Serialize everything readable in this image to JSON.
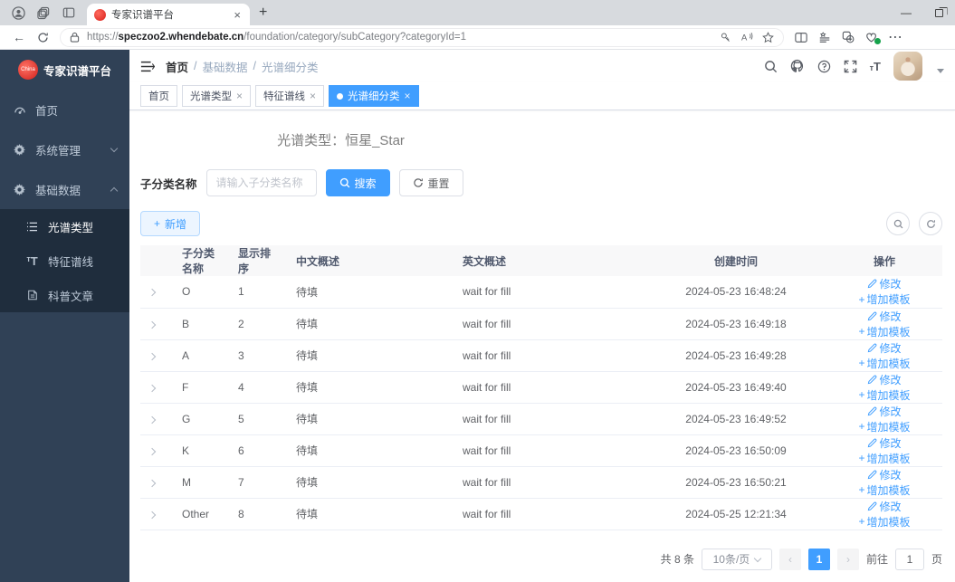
{
  "browser": {
    "tab_title": "专家识谱平台",
    "url": {
      "scheme": "https://",
      "host": "speczoo2.whendebate.cn",
      "path": "/foundation/category/subCategory?categoryId=1"
    }
  },
  "sidebar": {
    "logo_badge": "China",
    "title": "专家识谱平台",
    "menu": [
      {
        "label": "首页"
      },
      {
        "label": "系统管理"
      },
      {
        "label": "基础数据"
      }
    ],
    "submenu": [
      {
        "label": "光谱类型"
      },
      {
        "label": "特征谱线"
      },
      {
        "label": "科普文章"
      }
    ]
  },
  "navbar": {
    "breadcrumb": {
      "home": "首页",
      "sep1": "/",
      "mid": "基础数据",
      "sep2": "/",
      "last": "光谱细分类"
    }
  },
  "tags": [
    {
      "label": "首页"
    },
    {
      "label": "光谱类型"
    },
    {
      "label": "特征谱线"
    },
    {
      "label": "光谱细分类"
    }
  ],
  "page": {
    "title": "光谱类型：恒星_Star",
    "search_label": "子分类名称",
    "search_placeholder": "请输入子分类名称",
    "search_btn": "搜索",
    "reset_btn": "重置",
    "add_btn": "新增"
  },
  "table": {
    "columns": {
      "name": "子分类名称",
      "sort": "显示排序",
      "cn": "中文概述",
      "en": "英文概述",
      "created": "创建时间",
      "ops": "操作"
    },
    "ops": {
      "edit": "修改",
      "add_template": "增加模板"
    },
    "rows": [
      {
        "name": "O",
        "sort": "1",
        "cn": "待填",
        "en": "wait for fill",
        "created": "2024-05-23 16:48:24"
      },
      {
        "name": "B",
        "sort": "2",
        "cn": "待填",
        "en": "wait for fill",
        "created": "2024-05-23 16:49:18"
      },
      {
        "name": "A",
        "sort": "3",
        "cn": "待填",
        "en": "wait for fill",
        "created": "2024-05-23 16:49:28"
      },
      {
        "name": "F",
        "sort": "4",
        "cn": "待填",
        "en": "wait for fill",
        "created": "2024-05-23 16:49:40"
      },
      {
        "name": "G",
        "sort": "5",
        "cn": "待填",
        "en": "wait for fill",
        "created": "2024-05-23 16:49:52"
      },
      {
        "name": "K",
        "sort": "6",
        "cn": "待填",
        "en": "wait for fill",
        "created": "2024-05-23 16:50:09"
      },
      {
        "name": "M",
        "sort": "7",
        "cn": "待填",
        "en": "wait for fill",
        "created": "2024-05-23 16:50:21"
      },
      {
        "name": "Other",
        "sort": "8",
        "cn": "待填",
        "en": "wait for fill",
        "created": "2024-05-25 12:21:34"
      }
    ]
  },
  "pagination": {
    "total": "共 8 条",
    "page_size": "10条/页",
    "current_page": "1",
    "goto_prefix": "前往",
    "goto_value": "1",
    "goto_suffix": "页"
  },
  "colors": {
    "primary": "#409eff",
    "sidebar_bg": "#304156",
    "submenu_bg": "#1f2d3d",
    "tag_border": "#d8dce5",
    "link": "#409eff"
  }
}
